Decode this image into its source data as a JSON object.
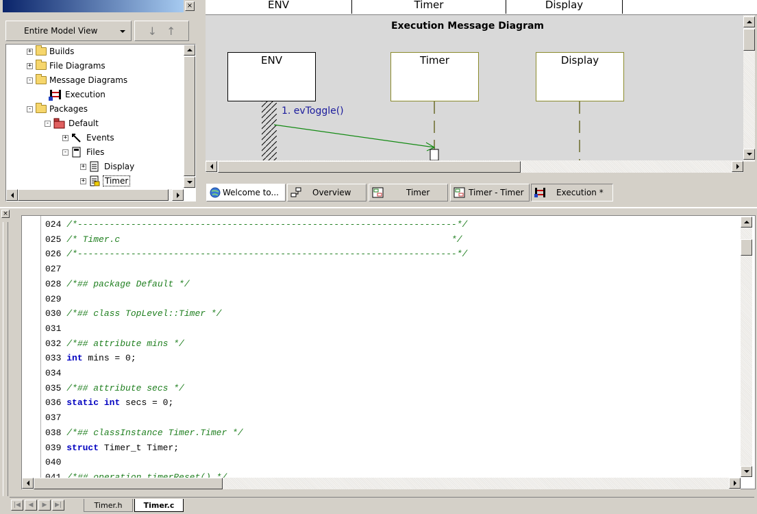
{
  "model_browser": {
    "view_label": "Entire Model View",
    "tree": [
      {
        "label": "Builds",
        "expander": "+"
      },
      {
        "label": "File Diagrams",
        "expander": "+"
      },
      {
        "label": "Message Diagrams",
        "expander": "-"
      },
      {
        "label": "Execution",
        "expander": ""
      },
      {
        "label": "Packages",
        "expander": "-"
      },
      {
        "label": "Default",
        "expander": "-"
      },
      {
        "label": "Events",
        "expander": "+"
      },
      {
        "label": "Files",
        "expander": "-"
      },
      {
        "label": "Display",
        "expander": "+"
      },
      {
        "label": "Timer",
        "expander": "+"
      }
    ]
  },
  "diagram": {
    "header_columns": [
      "ENV",
      "Timer",
      "Display"
    ],
    "title": "Execution Message Diagram",
    "lifelines": [
      "ENV",
      "Timer",
      "Display"
    ],
    "message": "1. evToggle()"
  },
  "diagram_tabs": [
    {
      "label": "Welcome to...",
      "icon": "globe-icon"
    },
    {
      "label": "Overview",
      "icon": "overview-icon"
    },
    {
      "label": "Timer",
      "icon": "statechart-icon"
    },
    {
      "label": "Timer - Timer",
      "icon": "statechart-icon"
    },
    {
      "label": "Execution *",
      "icon": "sequence-icon"
    }
  ],
  "code": {
    "lines": [
      {
        "num": "024",
        "parts": [
          {
            "t": "/*-----------------------------------------------------------------------*/",
            "c": "cm"
          }
        ]
      },
      {
        "num": "025",
        "parts": [
          {
            "t": "/* Timer.c                                                              */",
            "c": "cm"
          }
        ]
      },
      {
        "num": "026",
        "parts": [
          {
            "t": "/*-----------------------------------------------------------------------*/",
            "c": "cm"
          }
        ]
      },
      {
        "num": "027",
        "parts": []
      },
      {
        "num": "028",
        "parts": [
          {
            "t": "/*## package Default */",
            "c": "cm"
          }
        ]
      },
      {
        "num": "029",
        "parts": []
      },
      {
        "num": "030",
        "parts": [
          {
            "t": "/*## class TopLevel::Timer */",
            "c": "cm"
          }
        ]
      },
      {
        "num": "031",
        "parts": []
      },
      {
        "num": "032",
        "parts": [
          {
            "t": "/*## attribute mins */",
            "c": "cm"
          }
        ]
      },
      {
        "num": "033",
        "parts": [
          {
            "t": "int",
            "c": "kw"
          },
          {
            "t": " mins = 0;",
            "c": ""
          }
        ]
      },
      {
        "num": "034",
        "parts": []
      },
      {
        "num": "035",
        "parts": [
          {
            "t": "/*## attribute secs */",
            "c": "cm"
          }
        ]
      },
      {
        "num": "036",
        "parts": [
          {
            "t": "static",
            "c": "kw"
          },
          {
            "t": " ",
            "c": ""
          },
          {
            "t": "int",
            "c": "kw"
          },
          {
            "t": " secs = 0;",
            "c": ""
          }
        ]
      },
      {
        "num": "037",
        "parts": []
      },
      {
        "num": "038",
        "parts": [
          {
            "t": "/*## classInstance Timer.Timer */",
            "c": "cm"
          }
        ]
      },
      {
        "num": "039",
        "parts": [
          {
            "t": "struct",
            "c": "kw"
          },
          {
            "t": " Timer_t Timer;",
            "c": ""
          }
        ]
      },
      {
        "num": "040",
        "parts": []
      },
      {
        "num": "041",
        "parts": [
          {
            "t": "/*## operation timerReset() */",
            "c": "cm"
          }
        ]
      }
    ]
  },
  "file_tabs": [
    "Timer.h",
    "Timer.c"
  ]
}
